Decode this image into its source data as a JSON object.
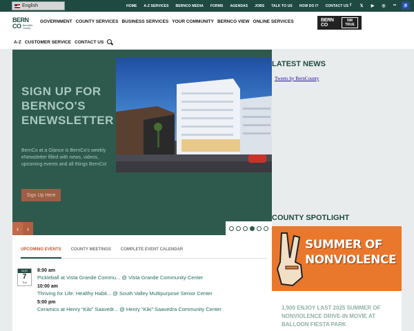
{
  "top_bar": {
    "language": "English",
    "links": [
      "HOME",
      "A-Z SERVICES",
      "BERNCO MEDIA",
      "FORMS",
      "AGENDAS",
      "JOBS",
      "TALK TO US",
      "HOW DO I?",
      "CONTACT US"
    ],
    "social_icons": [
      "facebook-icon",
      "x-icon",
      "youtube-icon",
      "instagram-icon",
      "flickr-icon",
      "accessibility-icon"
    ],
    "social_glyphs": [
      "f",
      "𝕏",
      "▶",
      "◎",
      "••",
      "♿"
    ],
    "colors": {
      "bar": "#1e4a42",
      "accessibility": "#2b4d8a"
    }
  },
  "header": {
    "logo": {
      "big": "BERN\nCO",
      "small": "Bernalillo County"
    },
    "nav": [
      "GOVERNMENT",
      "COUNTY SERVICES",
      "BUSINESS SERVICES",
      "YOUR COMMUNITY",
      "BERNCO VIEW",
      "ONLINE SERVICES"
    ],
    "subnav": [
      "A-Z",
      "CUSTOMER SERVICE",
      "CONTACT US"
    ],
    "badge": {
      "left": "BERN\nCO",
      "right": "NM\nTRUE"
    }
  },
  "hero": {
    "title": "SIGN UP FOR BERNCO'S ENEWSLETTER",
    "text": "BernCo at a Glance is BernCo's weekly eNewsletter filled with news, videos, upcoming events and all things BernCo!",
    "button": "Sign Up Here",
    "prev": "‹",
    "next": "›",
    "slide_count": 6,
    "active_slide": 4,
    "colors": {
      "panel": "#2e5a4e",
      "button": "#9c5f45",
      "arrow": "#c06a48"
    }
  },
  "events": {
    "tabs": [
      "UPCOMING EVENTS",
      "COUNTY MEETINGS",
      "COMPLETE EVENT CALENDAR"
    ],
    "active_tab": 0,
    "date": {
      "month": "AUG",
      "day": "7",
      "weekday": "Thu"
    },
    "items": [
      {
        "time": "8:00 am",
        "title": "Pickleball at Vista Grande Commu... @ Vista Grande Community Center"
      },
      {
        "time": "10:00 am",
        "title": "Thriving for Life: Healthy Habit... @ South Valley Multipurpose Senior Center"
      },
      {
        "time": "5:00 pm",
        "title": "Ceramics at Henry “Kiki” Saavedr... @ Henry “Kiki” Saavedra Community Center"
      }
    ]
  },
  "latest_news": {
    "title": "LATEST NEWS",
    "tweets_link": "Tweets by BernCounty"
  },
  "county_spotlight": {
    "title": "COUNTY SPOTLIGHT",
    "image_text": "SUMMER OF NONVIOLENCE",
    "headline": "1,900 ENJOY LAST 2025 SUMMER OF NONVIOLENCE DRIVE-IN MOVIE AT BALLOON FIESTA PARK",
    "colors": {
      "image_bg": "#e9782c",
      "headline": "#8fb0a6"
    }
  }
}
